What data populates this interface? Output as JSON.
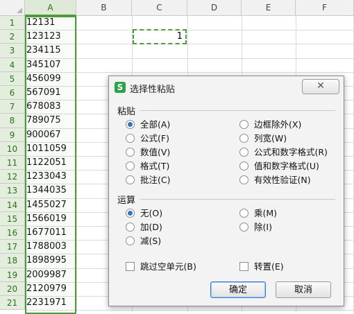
{
  "spreadsheet": {
    "columns": [
      "A",
      "B",
      "C",
      "D",
      "E",
      "F"
    ],
    "rows": [
      "1",
      "2",
      "3",
      "4",
      "5",
      "6",
      "7",
      "8",
      "9",
      "10",
      "11",
      "12",
      "13",
      "14",
      "15",
      "16",
      "17",
      "18",
      "19",
      "20",
      "21"
    ],
    "column_a_values": [
      "12131",
      "123123",
      "234115",
      "345107",
      "456099",
      "567091",
      "678083",
      "789075",
      "900067",
      "1011059",
      "1122051",
      "1233043",
      "1344035",
      "1455027",
      "1566019",
      "1677011",
      "1788003",
      "1898995",
      "2009987",
      "2120979",
      "2231971"
    ],
    "clipboard_cell_value": "1"
  },
  "dialog": {
    "icon_letter": "S",
    "title": "选择性粘贴",
    "close_symbol": "✕",
    "paste_group_label": "粘贴",
    "paste_options_left": [
      "全部(A)",
      "公式(F)",
      "数值(V)",
      "格式(T)",
      "批注(C)"
    ],
    "paste_options_right": [
      "边框除外(X)",
      "列宽(W)",
      "公式和数字格式(R)",
      "值和数字格式(U)",
      "有效性验证(N)"
    ],
    "operation_group_label": "运算",
    "operation_options_left": [
      "无(O)",
      "加(D)",
      "减(S)"
    ],
    "operation_options_right": [
      "乘(M)",
      "除(I)"
    ],
    "skip_blanks_label": "跳过空单元(B)",
    "transpose_label": "转置(E)",
    "ok_label": "确定",
    "cancel_label": "取消",
    "selected_paste_option": "全部(A)",
    "selected_operation": "无(O)"
  },
  "colors": {
    "selection_green": "#4e9a3c",
    "radio_dot": "#3a6fc4",
    "app_icon": "#29a24a"
  }
}
